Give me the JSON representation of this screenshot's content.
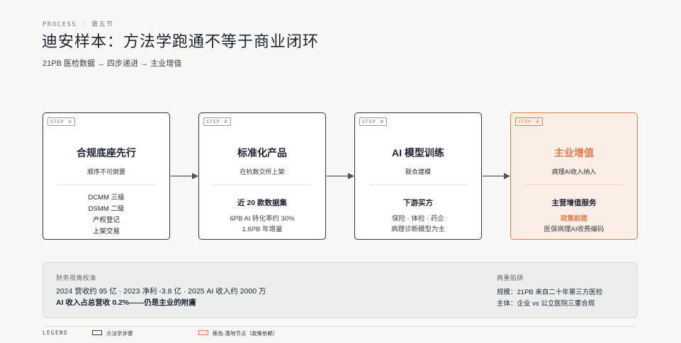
{
  "header": {
    "kicker": "PROCESS · 第五节",
    "title": "迪安样本：方法学跑通不等于商业闭环",
    "subtitle": "21PB 医检数据 → 四步递进 → 主业增值"
  },
  "steps": [
    {
      "tag": "STEP ①",
      "title": "合规底座先行",
      "subtitle": "顺序不可倒置",
      "items": [
        "DCMM 三级",
        "DSMM 二级",
        "产权登记",
        "上架交易"
      ]
    },
    {
      "tag": "STEP ②",
      "title": "标准化产品",
      "subtitle": "在杭数交所上架",
      "head": "近 20 款数据集",
      "body": [
        "6PB AI 转化率约 30%",
        "1.6PB 年增量"
      ]
    },
    {
      "tag": "STEP ③",
      "title": "AI 模型训练",
      "subtitle": "联合建模",
      "head": "下游买方",
      "body": [
        "保险 · 体检 · 药企",
        "病理诊断模型为主"
      ]
    },
    {
      "tag": "STEP ④",
      "title": "主业增值",
      "subtitle": "病理AI收入纳入",
      "head": "主营增值服务",
      "body_highlight": "政策前提",
      "body": [
        "医保病理AI收费编码"
      ]
    }
  ],
  "finance": {
    "label": "财务视角校准",
    "line1": "2024 营收约 95 亿 · 2023 净利 -3.8 亿 · 2025 AI 收入约 2000 万",
    "line2": "AI 收入占总营收 0.2%——仍是主业的附庸"
  },
  "traps": {
    "label": "两重陷阱",
    "line1": "规模：21PB 来自二十年第三方医检",
    "line2": "主体：企业 vs 公立医院三重合规"
  },
  "legend": {
    "title": "LEGEND",
    "method": "方法学步骤",
    "accent": "焦色·落地节点（政策依赖）"
  },
  "colors": {
    "accent": "#e07a4a",
    "ink": "#2e3440",
    "background": "#f7f7f5"
  }
}
